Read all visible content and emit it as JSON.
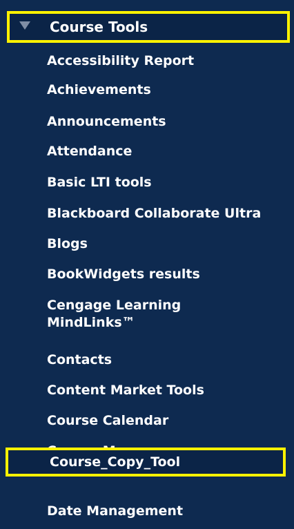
{
  "course_tools": {
    "header": "Course Tools",
    "items": [
      "Accessibility Report",
      "Achievements",
      "Announcements",
      "Attendance",
      "Basic LTI tools",
      "Blackboard Collaborate Ultra",
      "Blogs",
      "BookWidgets results",
      "Cengage Learning MindLinks™",
      "Contacts",
      "Content Market Tools",
      "Course Calendar",
      "Course Messages",
      "Course_Copy_Tool",
      "Date Management"
    ]
  },
  "colors": {
    "panel_background": "#0e2a50",
    "highlight_border": "#fff200",
    "text": "#ffffff",
    "collapse_arrow": "#7f8ea5"
  },
  "icons": {
    "header_toggle": "triangle-down-icon"
  }
}
